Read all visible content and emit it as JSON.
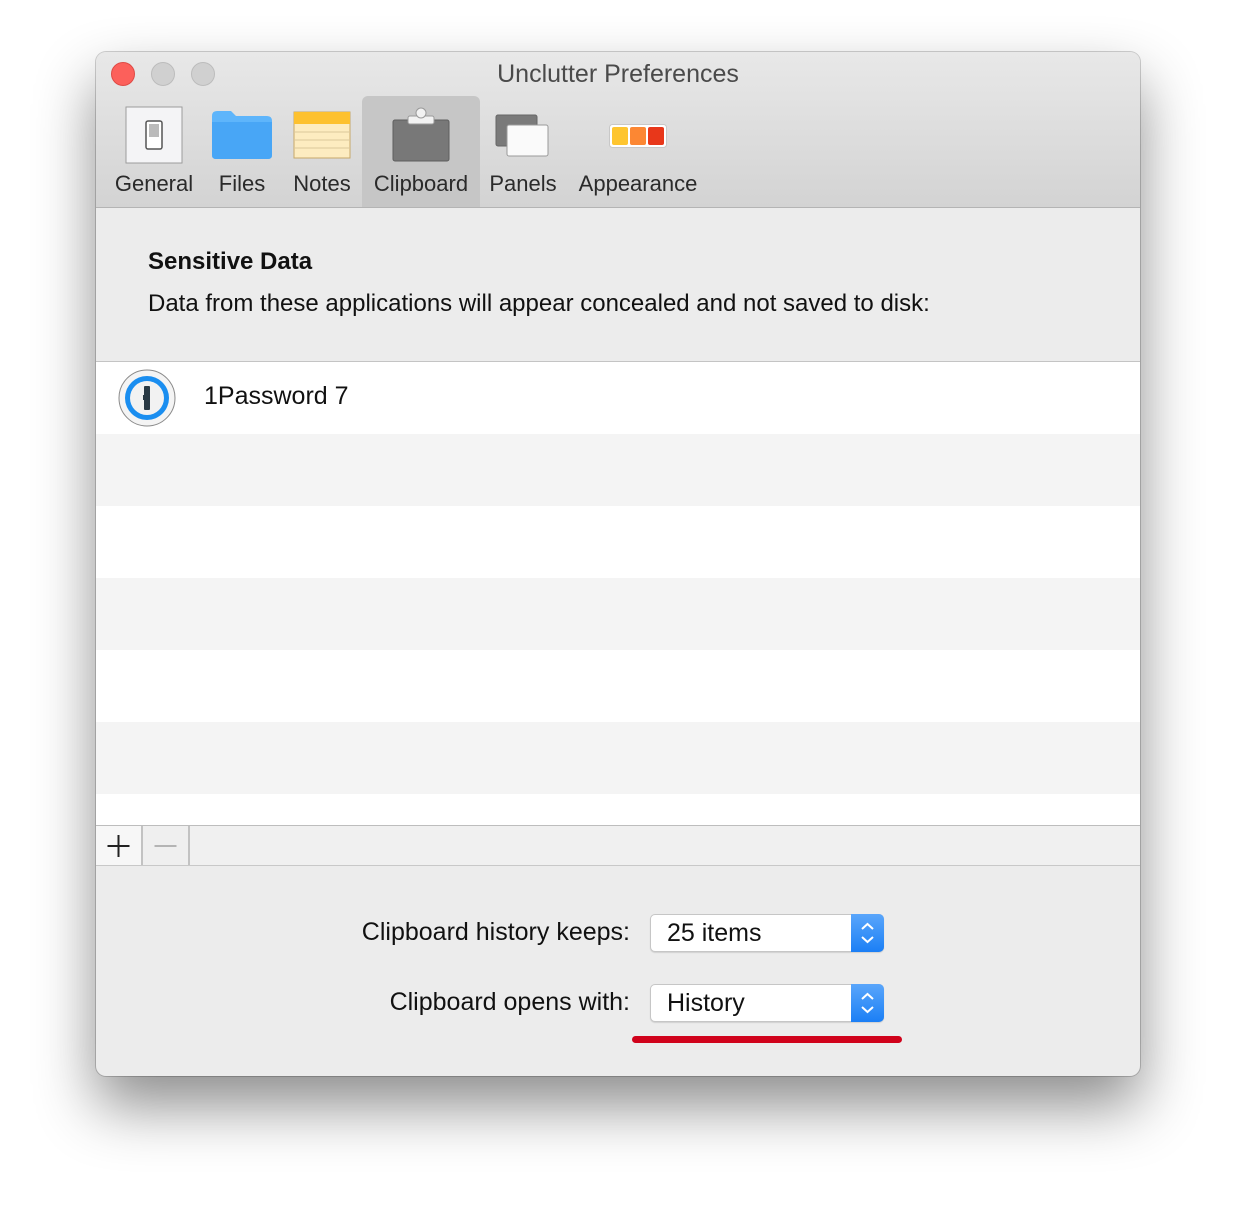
{
  "window": {
    "title": "Unclutter Preferences",
    "controls": [
      "close",
      "minimize",
      "zoom"
    ]
  },
  "toolbar": {
    "tabs": [
      {
        "label": "General",
        "icon": "light-switch-icon",
        "selected": false
      },
      {
        "label": "Files",
        "icon": "folder-icon",
        "selected": false
      },
      {
        "label": "Notes",
        "icon": "notepad-icon",
        "selected": false
      },
      {
        "label": "Clipboard",
        "icon": "clipboard-icon",
        "selected": true
      },
      {
        "label": "Panels",
        "icon": "panels-icon",
        "selected": false
      },
      {
        "label": "Appearance",
        "icon": "color-swatches-icon",
        "selected": false
      }
    ]
  },
  "sensitive": {
    "heading": "Sensitive Data",
    "description": "Data from these applications will appear concealed and not saved to disk:",
    "apps": [
      {
        "name": "1Password 7",
        "icon": "1password-icon"
      }
    ],
    "add_label": "+",
    "remove_label": "−"
  },
  "settings": {
    "history_label": "Clipboard history keeps:",
    "history_value": "25 items",
    "opens_label": "Clipboard opens with:",
    "opens_value": "History"
  },
  "colors": {
    "accent_blue": "#1b7ff5",
    "annotation_red": "#d0021b",
    "close_red": "#fc605b"
  }
}
